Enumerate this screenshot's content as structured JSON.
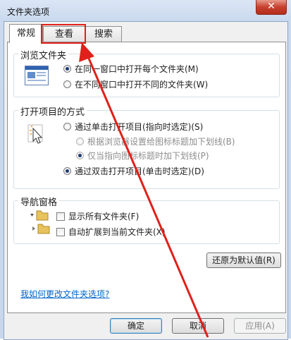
{
  "window": {
    "title": "文件夹选项",
    "close_glyph": "✕"
  },
  "tabs": [
    {
      "label": "常规",
      "active": true
    },
    {
      "label": "查看",
      "active": false
    },
    {
      "label": "搜索",
      "active": false
    }
  ],
  "browse_folders": {
    "title": "浏览文件夹",
    "options": [
      {
        "label": "在同一窗口中打开每个文件夹(M)",
        "checked": true
      },
      {
        "label": "在不同窗口中打开不同的文件夹(W)",
        "checked": false
      }
    ]
  },
  "click_items": {
    "title": "打开项目的方式",
    "options": [
      {
        "label": "通过单击打开项目(指向时选定)(S)",
        "checked": false,
        "disabled": false
      },
      {
        "label": "根据浏览器设置给图标标题加下划线(B)",
        "checked": false,
        "disabled": true
      },
      {
        "label": "仅当指向图标标题时加下划线(P)",
        "checked": true,
        "disabled": true
      },
      {
        "label": "通过双击打开项目(单击时选定)(D)",
        "checked": true,
        "disabled": false
      }
    ]
  },
  "nav_pane": {
    "title": "导航窗格",
    "options": [
      {
        "label": "显示所有文件夹(F)",
        "checked": false
      },
      {
        "label": "自动扩展到当前文件夹(X)",
        "checked": false
      }
    ]
  },
  "restore_defaults_label": "还原为默认值(R)",
  "help_link": "我如何更改文件夹选项?",
  "buttons": {
    "ok": "确定",
    "cancel": "取消",
    "apply": "应用(A)"
  },
  "annotation_color": "#e0201a"
}
